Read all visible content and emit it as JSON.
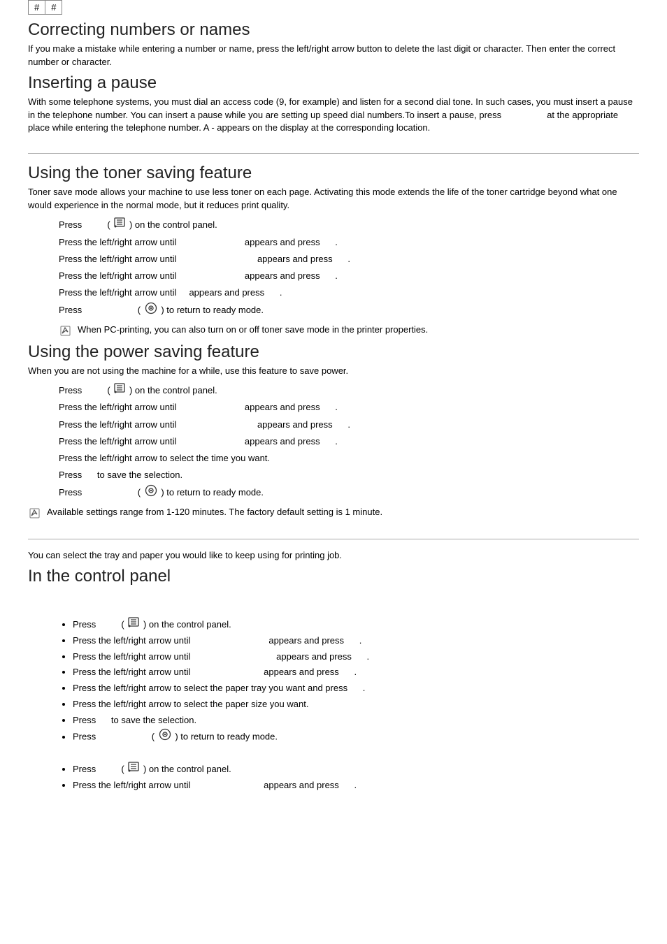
{
  "hash_table": {
    "c1": "#",
    "c2": "#"
  },
  "sec_correcting": {
    "title": "Correcting numbers or names",
    "body": "If you make a mistake while entering a number or name, press the left/right arrow button to delete the last digit or character. Then enter the correct number or character."
  },
  "sec_pause": {
    "title": "Inserting a pause",
    "body_a": "With some telephone systems, you must dial an access code (9, for example) and listen for a second dial tone. In such cases, you must insert a pause in the telephone number. You can insert a pause while you are setting up speed dial numbers.To insert a pause, press ",
    "body_b": " at the appropriate place while entering the telephone number. A - appears on the display at the corresponding location."
  },
  "sec_toner": {
    "title": "Using the toner saving feature",
    "body": "Toner save mode allows your machine to use less toner on each page. Activating this mode extends the life of the toner cartridge beyond what one would experience in the normal mode, but it reduces print quality.",
    "steps": [
      {
        "a": "Press ",
        "b": " (",
        "c": ") on the control panel."
      },
      {
        "a": "Press the left/right arrow until ",
        "b": " appears and press ",
        "c": "."
      },
      {
        "a": "Press the left/right arrow until ",
        "b": " appears and press ",
        "c": "."
      },
      {
        "a": "Press the left/right arrow until ",
        "b": " appears and press ",
        "c": "."
      },
      {
        "a": "Press the left/right arrow until ",
        "b": " appears and press ",
        "c": "."
      },
      {
        "a": "Press ",
        "b": " (",
        "c": ") to return to ready mode."
      }
    ],
    "note": "When PC-printing, you can also turn on or off toner save mode in the printer properties."
  },
  "sec_power": {
    "title": "Using the power saving feature",
    "body": "When you are not using the machine for a while, use this feature to save power.",
    "steps": [
      {
        "a": "Press ",
        "b": " (",
        "c": ") on the control panel."
      },
      {
        "a": "Press the left/right arrow until ",
        "b": " appears and press ",
        "c": "."
      },
      {
        "a": "Press the left/right arrow until ",
        "b": " appears and press ",
        "c": "."
      },
      {
        "a": "Press the left/right arrow until ",
        "b": " appears and press ",
        "c": "."
      },
      {
        "a": "Press the left/right arrow to select the time you want."
      },
      {
        "a": "Press ",
        "b": " to save the selection."
      },
      {
        "a": "Press ",
        "b": " (",
        "c": ") to return to ready mode."
      }
    ],
    "note": "Available settings range from 1-120 minutes. The factory default setting is 1 minute."
  },
  "sec_tray": {
    "intro": "You can select the tray and paper you would like to keep using for printing job.",
    "title": "In the control panel",
    "group1": [
      {
        "a": "Press ",
        "b": " (",
        "c": ") on the control panel."
      },
      {
        "a": "Press the left/right arrow until ",
        "b": " appears and press ",
        "c": "."
      },
      {
        "a": "Press the left/right arrow until ",
        "b": " appears and press ",
        "c": "."
      },
      {
        "a": "Press the left/right arrow until ",
        "b": " appears and press ",
        "c": "."
      },
      {
        "a": "Press the left/right arrow to select the paper tray you want and press ",
        "b": "."
      },
      {
        "a": "Press the left/right arrow to select the paper size you want."
      },
      {
        "a": "Press ",
        "b": " to save the selection."
      },
      {
        "a": "Press ",
        "b": " (",
        "c": ") to return to ready mode."
      }
    ],
    "group2": [
      {
        "a": "Press ",
        "b": " (",
        "c": ") on the control panel."
      },
      {
        "a": "Press the left/right arrow until ",
        "b": " appears and press ",
        "c": "."
      }
    ]
  },
  "icons": {
    "menu": "menu-icon",
    "stop": "stop-clear-icon",
    "note": "note-icon"
  }
}
